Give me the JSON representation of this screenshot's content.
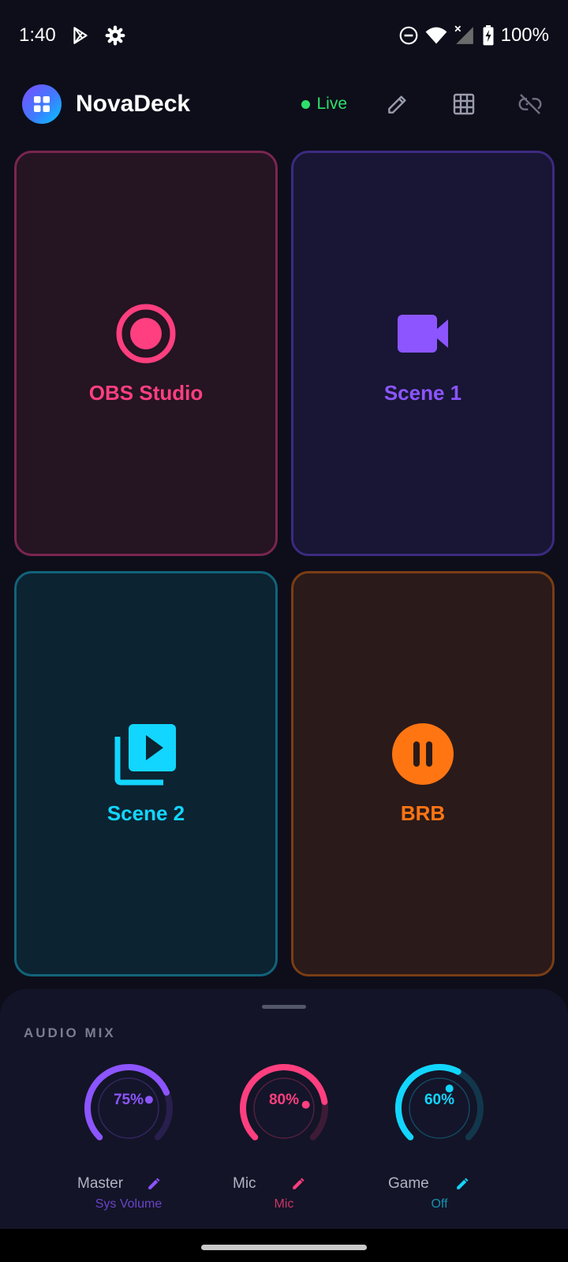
{
  "status_bar": {
    "time": "1:40",
    "battery": "100%",
    "icons": [
      "play-store-icon",
      "settings-icon",
      "dnd-icon",
      "wifi-icon",
      "signal-icon",
      "battery-charging-icon"
    ]
  },
  "header": {
    "title": "NovaDeck",
    "live_label": "Live",
    "icons": [
      "app-grid-icon",
      "edit-icon",
      "grid-layout-icon",
      "link-off-icon"
    ],
    "live_color": "#2ee06b"
  },
  "deck_buttons": [
    {
      "label": "OBS Studio",
      "icon": "record-icon",
      "color": "#ff3f7f"
    },
    {
      "label": "Scene 1",
      "icon": "video-camera-icon",
      "color": "#8c55ff"
    },
    {
      "label": "Scene 2",
      "icon": "video-library-icon",
      "color": "#12d6ff"
    },
    {
      "label": "BRB",
      "icon": "pause-circle-icon",
      "color": "#ff7512"
    }
  ],
  "audio_mix": {
    "title": "AUDIO MIX",
    "channels": [
      {
        "name": "Master",
        "value": "75%",
        "level": 0.75,
        "sub": "Sys Volume",
        "color": "#8c55ff",
        "sub_color": "#6a44c8"
      },
      {
        "name": "Mic",
        "value": "80%",
        "level": 0.8,
        "sub": "Mic",
        "color": "#ff3f7f",
        "sub_color": "#c93468"
      },
      {
        "name": "Game",
        "value": "60%",
        "level": 0.6,
        "sub": "Off",
        "color": "#12d6ff",
        "sub_color": "#1690ad"
      }
    ]
  }
}
